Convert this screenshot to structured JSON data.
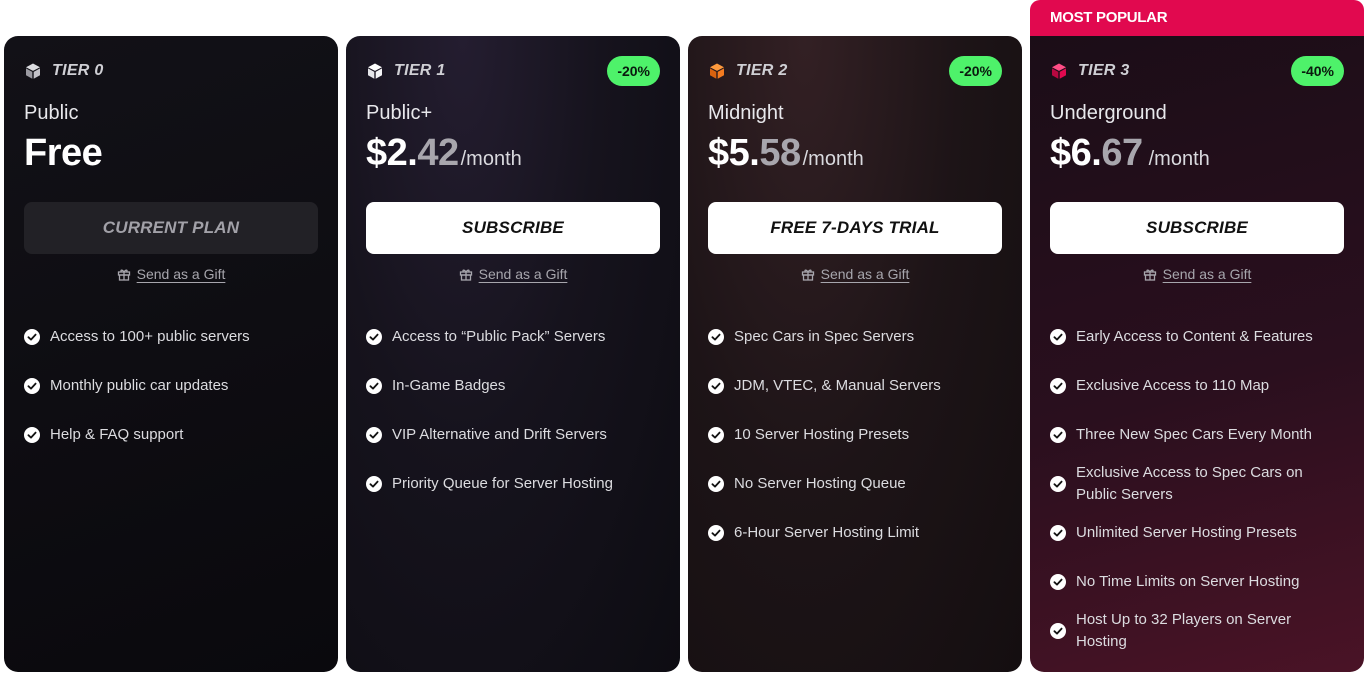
{
  "popular_label": "MOST POPULAR",
  "colors": {
    "accent_pink": "#e1094f",
    "discount_green": "#4ef26a",
    "tier0_icon": "#c9c9cf",
    "tier1_icon": "#ffffff",
    "tier2_icon": "#f47b20",
    "tier3_icon": "#e1094f"
  },
  "gift_label": "Send as a Gift",
  "plans": [
    {
      "tier": "TIER 0",
      "name": "Public",
      "price_main": "Free",
      "price_dim": "",
      "price_per": "",
      "discount": "",
      "cta": "CURRENT PLAN",
      "features": [
        "Access to 100+ public servers",
        "Monthly public car updates",
        "Help & FAQ support"
      ]
    },
    {
      "tier": "TIER 1",
      "name": "Public+",
      "price_main": "$2.",
      "price_dim": "42",
      "price_per": "/month",
      "discount": "-20%",
      "cta": "SUBSCRIBE",
      "features": [
        "Access to “Public Pack” Servers",
        "In-Game Badges",
        "VIP Alternative and Drift Servers",
        "Priority Queue for Server Hosting"
      ]
    },
    {
      "tier": "TIER 2",
      "name": "Midnight",
      "price_main": "$5.",
      "price_dim": "58",
      "price_per": "/month",
      "discount": "-20%",
      "cta": "FREE 7-DAYS TRIAL",
      "features": [
        "Spec Cars in Spec Servers",
        "JDM, VTEC, & Manual Servers",
        "10 Server Hosting Presets",
        "No Server Hosting Queue",
        "6-Hour Server Hosting Limit"
      ]
    },
    {
      "tier": "TIER 3",
      "name": "Underground",
      "price_main": "$6.",
      "price_dim": "67",
      "price_per": "/month",
      "discount": "-40%",
      "cta": "SUBSCRIBE",
      "features": [
        "Early Access to Content & Features",
        "Exclusive Access to 110 Map",
        "Three New Spec Cars Every Month",
        "Exclusive Access to Spec Cars on Public Servers",
        "Unlimited Server Hosting Presets",
        "No Time Limits on Server Hosting",
        "Host Up to 32 Players on Server Hosting"
      ]
    }
  ]
}
